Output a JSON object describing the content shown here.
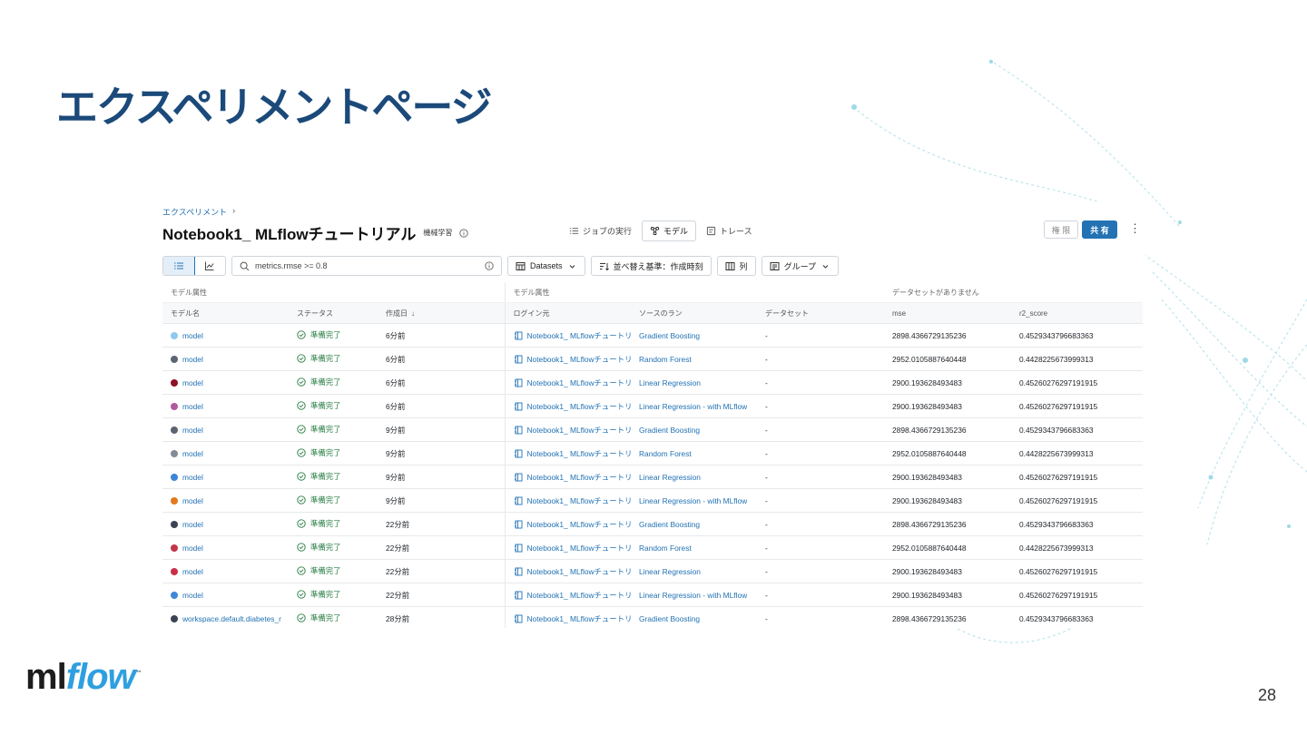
{
  "slide": {
    "title": "エクスペリメントページ",
    "page_number": "28",
    "logo": {
      "ml": "ml",
      "flow": "flow",
      "tm": "™"
    }
  },
  "screen": {
    "breadcrumb": {
      "label": "エクスペリメント",
      "separator": "›"
    },
    "experiment_title": "Notebook1_ MLflowチュートリアル",
    "experiment_tag": "機械学習",
    "view_tabs": [
      {
        "label": "ジョブの実行",
        "icon": "list-icon"
      },
      {
        "label": "モデル",
        "icon": "model-icon"
      },
      {
        "label": "トレース",
        "icon": "trace-icon"
      }
    ],
    "permissions_label": "権 限",
    "share_label": "共 有",
    "more_label": "⋮",
    "search": {
      "value": "metrics.rmse >= 0.8"
    },
    "toolbar": {
      "datasets_label": "Datasets",
      "sort_label": "並べ替え基準：作成時刻",
      "columns_label": "列",
      "group_label": "グループ"
    },
    "table": {
      "group_headers": [
        "モデル属性",
        "モデル属性",
        "データセットがありません"
      ],
      "columns": [
        "モデル名",
        "ステータス",
        "作成日",
        "ログイン元",
        "ソースのラン",
        "データセット",
        "mse",
        "r2_score"
      ],
      "sort_indicator": "↓",
      "rows": [
        {
          "color": "#8fc9ef",
          "name": "model",
          "status": "準備完了",
          "created": "6分前",
          "logged_from": "Notebook1_ MLflowチュートリ",
          "source_run": "Gradient Boosting",
          "dataset": "-",
          "mse": "2898.4366729135236",
          "r2": "0.4529343796683363"
        },
        {
          "color": "#5b6573",
          "name": "model",
          "status": "準備完了",
          "created": "6分前",
          "logged_from": "Notebook1_ MLflowチュートリ",
          "source_run": "Random Forest",
          "dataset": "-",
          "mse": "2952.0105887640448",
          "r2": "0.4428225673999313"
        },
        {
          "color": "#8c1026",
          "name": "model",
          "status": "準備完了",
          "created": "6分前",
          "logged_from": "Notebook1_ MLflowチュートリ",
          "source_run": "Linear Regression",
          "dataset": "-",
          "mse": "2900.193628493483",
          "r2": "0.45260276297191915"
        },
        {
          "color": "#b25a9e",
          "name": "model",
          "status": "準備完了",
          "created": "6分前",
          "logged_from": "Notebook1_ MLflowチュートリ",
          "source_run": "Linear Regression - with MLflow",
          "dataset": "-",
          "mse": "2900.193628493483",
          "r2": "0.45260276297191915"
        },
        {
          "color": "#5c6470",
          "name": "model",
          "status": "準備完了",
          "created": "9分前",
          "logged_from": "Notebook1_ MLflowチュートリ",
          "source_run": "Gradient Boosting",
          "dataset": "-",
          "mse": "2898.4366729135236",
          "r2": "0.4529343796683363"
        },
        {
          "color": "#838b94",
          "name": "model",
          "status": "準備完了",
          "created": "9分前",
          "logged_from": "Notebook1_ MLflowチュートリ",
          "source_run": "Random Forest",
          "dataset": "-",
          "mse": "2952.0105887640448",
          "r2": "0.4428225673999313"
        },
        {
          "color": "#3d86d6",
          "name": "model",
          "status": "準備完了",
          "created": "9分前",
          "logged_from": "Notebook1_ MLflowチュートリ",
          "source_run": "Linear Regression",
          "dataset": "-",
          "mse": "2900.193628493483",
          "r2": "0.45260276297191915"
        },
        {
          "color": "#e3781f",
          "name": "model",
          "status": "準備完了",
          "created": "9分前",
          "logged_from": "Notebook1_ MLflowチュートリ",
          "source_run": "Linear Regression - with MLflow",
          "dataset": "-",
          "mse": "2900.193628493483",
          "r2": "0.45260276297191915"
        },
        {
          "color": "#3b4352",
          "name": "model",
          "status": "準備完了",
          "created": "22分前",
          "logged_from": "Notebook1_ MLflowチュートリ",
          "source_run": "Gradient Boosting",
          "dataset": "-",
          "mse": "2898.4366729135236",
          "r2": "0.4529343796683363"
        },
        {
          "color": "#c2364a",
          "name": "model",
          "status": "準備完了",
          "created": "22分前",
          "logged_from": "Notebook1_ MLflowチュートリ",
          "source_run": "Random Forest",
          "dataset": "-",
          "mse": "2952.0105887640448",
          "r2": "0.4428225673999313"
        },
        {
          "color": "#c8304a",
          "name": "model",
          "status": "準備完了",
          "created": "22分前",
          "logged_from": "Notebook1_ MLflowチュートリ",
          "source_run": "Linear Regression",
          "dataset": "-",
          "mse": "2900.193628493483",
          "r2": "0.45260276297191915"
        },
        {
          "color": "#3e88d8",
          "name": "model",
          "status": "準備完了",
          "created": "22分前",
          "logged_from": "Notebook1_ MLflowチュートリ",
          "source_run": "Linear Regression - with MLflow",
          "dataset": "-",
          "mse": "2900.193628493483",
          "r2": "0.45260276297191915"
        },
        {
          "color": "#3b4352",
          "name": "workspace.default.diabetes_r",
          "status": "準備完了",
          "created": "28分前",
          "logged_from": "Notebook1_ MLflowチュートリ",
          "source_run": "Gradient Boosting",
          "dataset": "-",
          "mse": "2898.4366729135236",
          "r2": "0.4529343796683363"
        }
      ]
    }
  },
  "colors": {
    "title": "#1b4a7a",
    "accent": "#2272b4",
    "status_ok": "#277c43",
    "logo_flow": "#2f9fe0"
  }
}
